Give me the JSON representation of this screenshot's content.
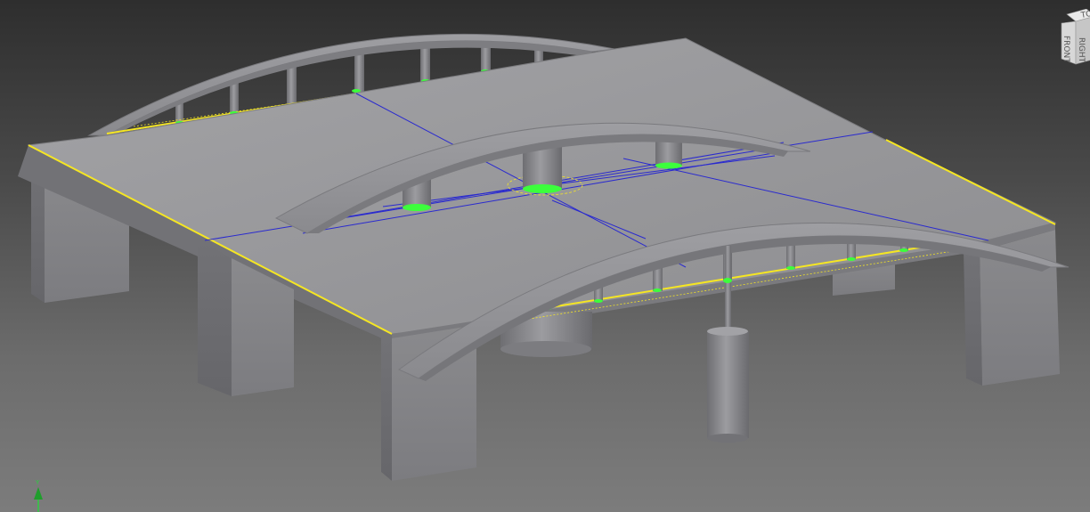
{
  "app": {
    "viewport_background_top": "#2e2e2e",
    "viewport_background_bottom": "#7c7c7c"
  },
  "model": {
    "surface_color": "#9a9a9c",
    "shadow_color": "#6e6e72",
    "selected_edge_color": "#f5e623",
    "sketch_line_color": "#2a2acf",
    "highlight_color": "#3cff3c"
  },
  "viewcube": {
    "icon": "view-cube-icon",
    "visible_faces": [
      "FRONT",
      "RIGHT",
      "TOP"
    ],
    "front_label": "FRONT",
    "right_label": "RIGHT",
    "top_label": "TOP"
  },
  "triad": {
    "icon": "coordinate-triad-icon",
    "axis_label": "Y"
  }
}
